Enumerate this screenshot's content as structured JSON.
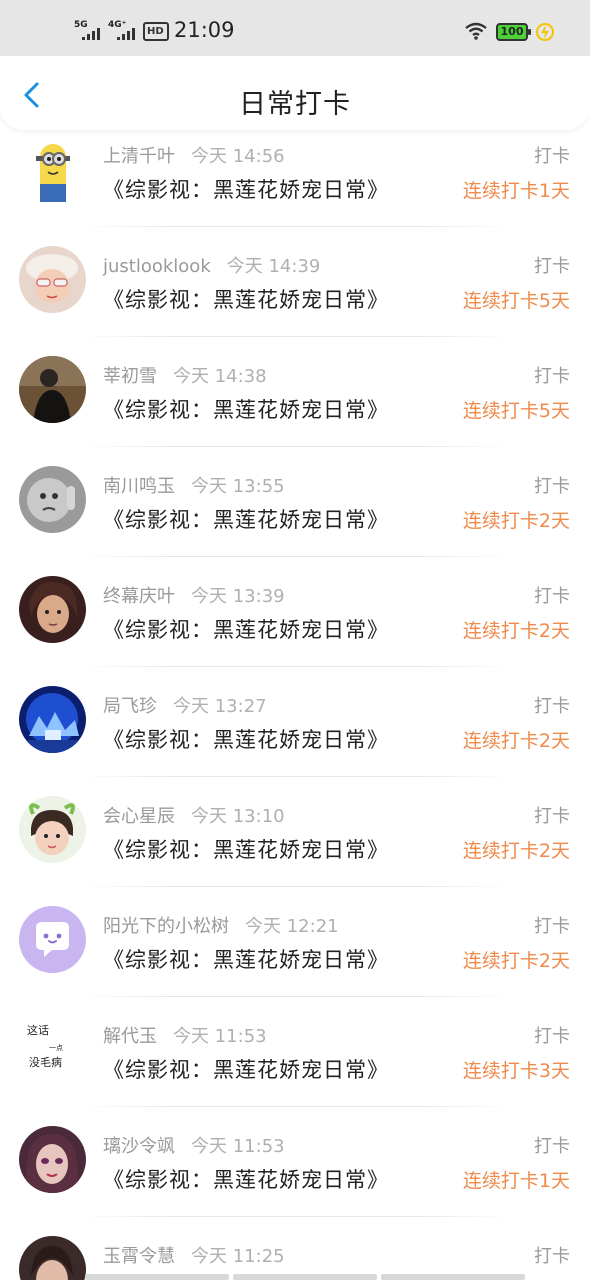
{
  "status_bar": {
    "signal1_label": "5G",
    "signal2_label": "4G⁺",
    "hd_label": "HD",
    "time": "21:09",
    "battery": "100",
    "wifi_icon": "wifi-icon",
    "charging_icon": "lightning-icon"
  },
  "header": {
    "title": "日常打卡",
    "back_icon": "chevron-left-icon"
  },
  "colors": {
    "accent_blue": "#1a8fe3",
    "streak_orange": "#f08a4b",
    "meta_gray": "#9a9a9a",
    "avatar_placeholder_purple": "#c9b5f0"
  },
  "checkins": [
    {
      "name": "上清千叶",
      "time": "今天 14:56",
      "tag": "打卡",
      "book": "《综影视：黑莲花娇宠日常》",
      "streak": "连续打卡1天"
    },
    {
      "name": "justlooklook",
      "time": "今天 14:39",
      "tag": "打卡",
      "book": "《综影视：黑莲花娇宠日常》",
      "streak": "连续打卡5天"
    },
    {
      "name": "莘初雪",
      "time": "今天 14:38",
      "tag": "打卡",
      "book": "《综影视：黑莲花娇宠日常》",
      "streak": "连续打卡5天"
    },
    {
      "name": "南川鸣玉",
      "time": "今天 13:55",
      "tag": "打卡",
      "book": "《综影视：黑莲花娇宠日常》",
      "streak": "连续打卡2天"
    },
    {
      "name": "终幕庆叶",
      "time": "今天 13:39",
      "tag": "打卡",
      "book": "《综影视：黑莲花娇宠日常》",
      "streak": "连续打卡2天"
    },
    {
      "name": "局飞珍",
      "time": "今天 13:27",
      "tag": "打卡",
      "book": "《综影视：黑莲花娇宠日常》",
      "streak": "连续打卡2天"
    },
    {
      "name": "会心星辰",
      "time": "今天 13:10",
      "tag": "打卡",
      "book": "《综影视：黑莲花娇宠日常》",
      "streak": "连续打卡2天"
    },
    {
      "name": "阳光下的小松树",
      "time": "今天 12:21",
      "tag": "打卡",
      "book": "《综影视：黑莲花娇宠日常》",
      "streak": "连续打卡2天"
    },
    {
      "name": "解代玉",
      "time": "今天 11:53",
      "tag": "打卡",
      "book": "《综影视：黑莲花娇宠日常》",
      "streak": "连续打卡3天",
      "avatar_text": [
        "这话",
        "一点",
        "没毛病"
      ]
    },
    {
      "name": "璃沙令飒",
      "time": "今天 11:53",
      "tag": "打卡",
      "book": "《综影视：黑莲花娇宠日常》",
      "streak": "连续打卡1天"
    },
    {
      "name": "玉霄令慧",
      "time": "今天 11:25",
      "tag": "打卡"
    }
  ]
}
